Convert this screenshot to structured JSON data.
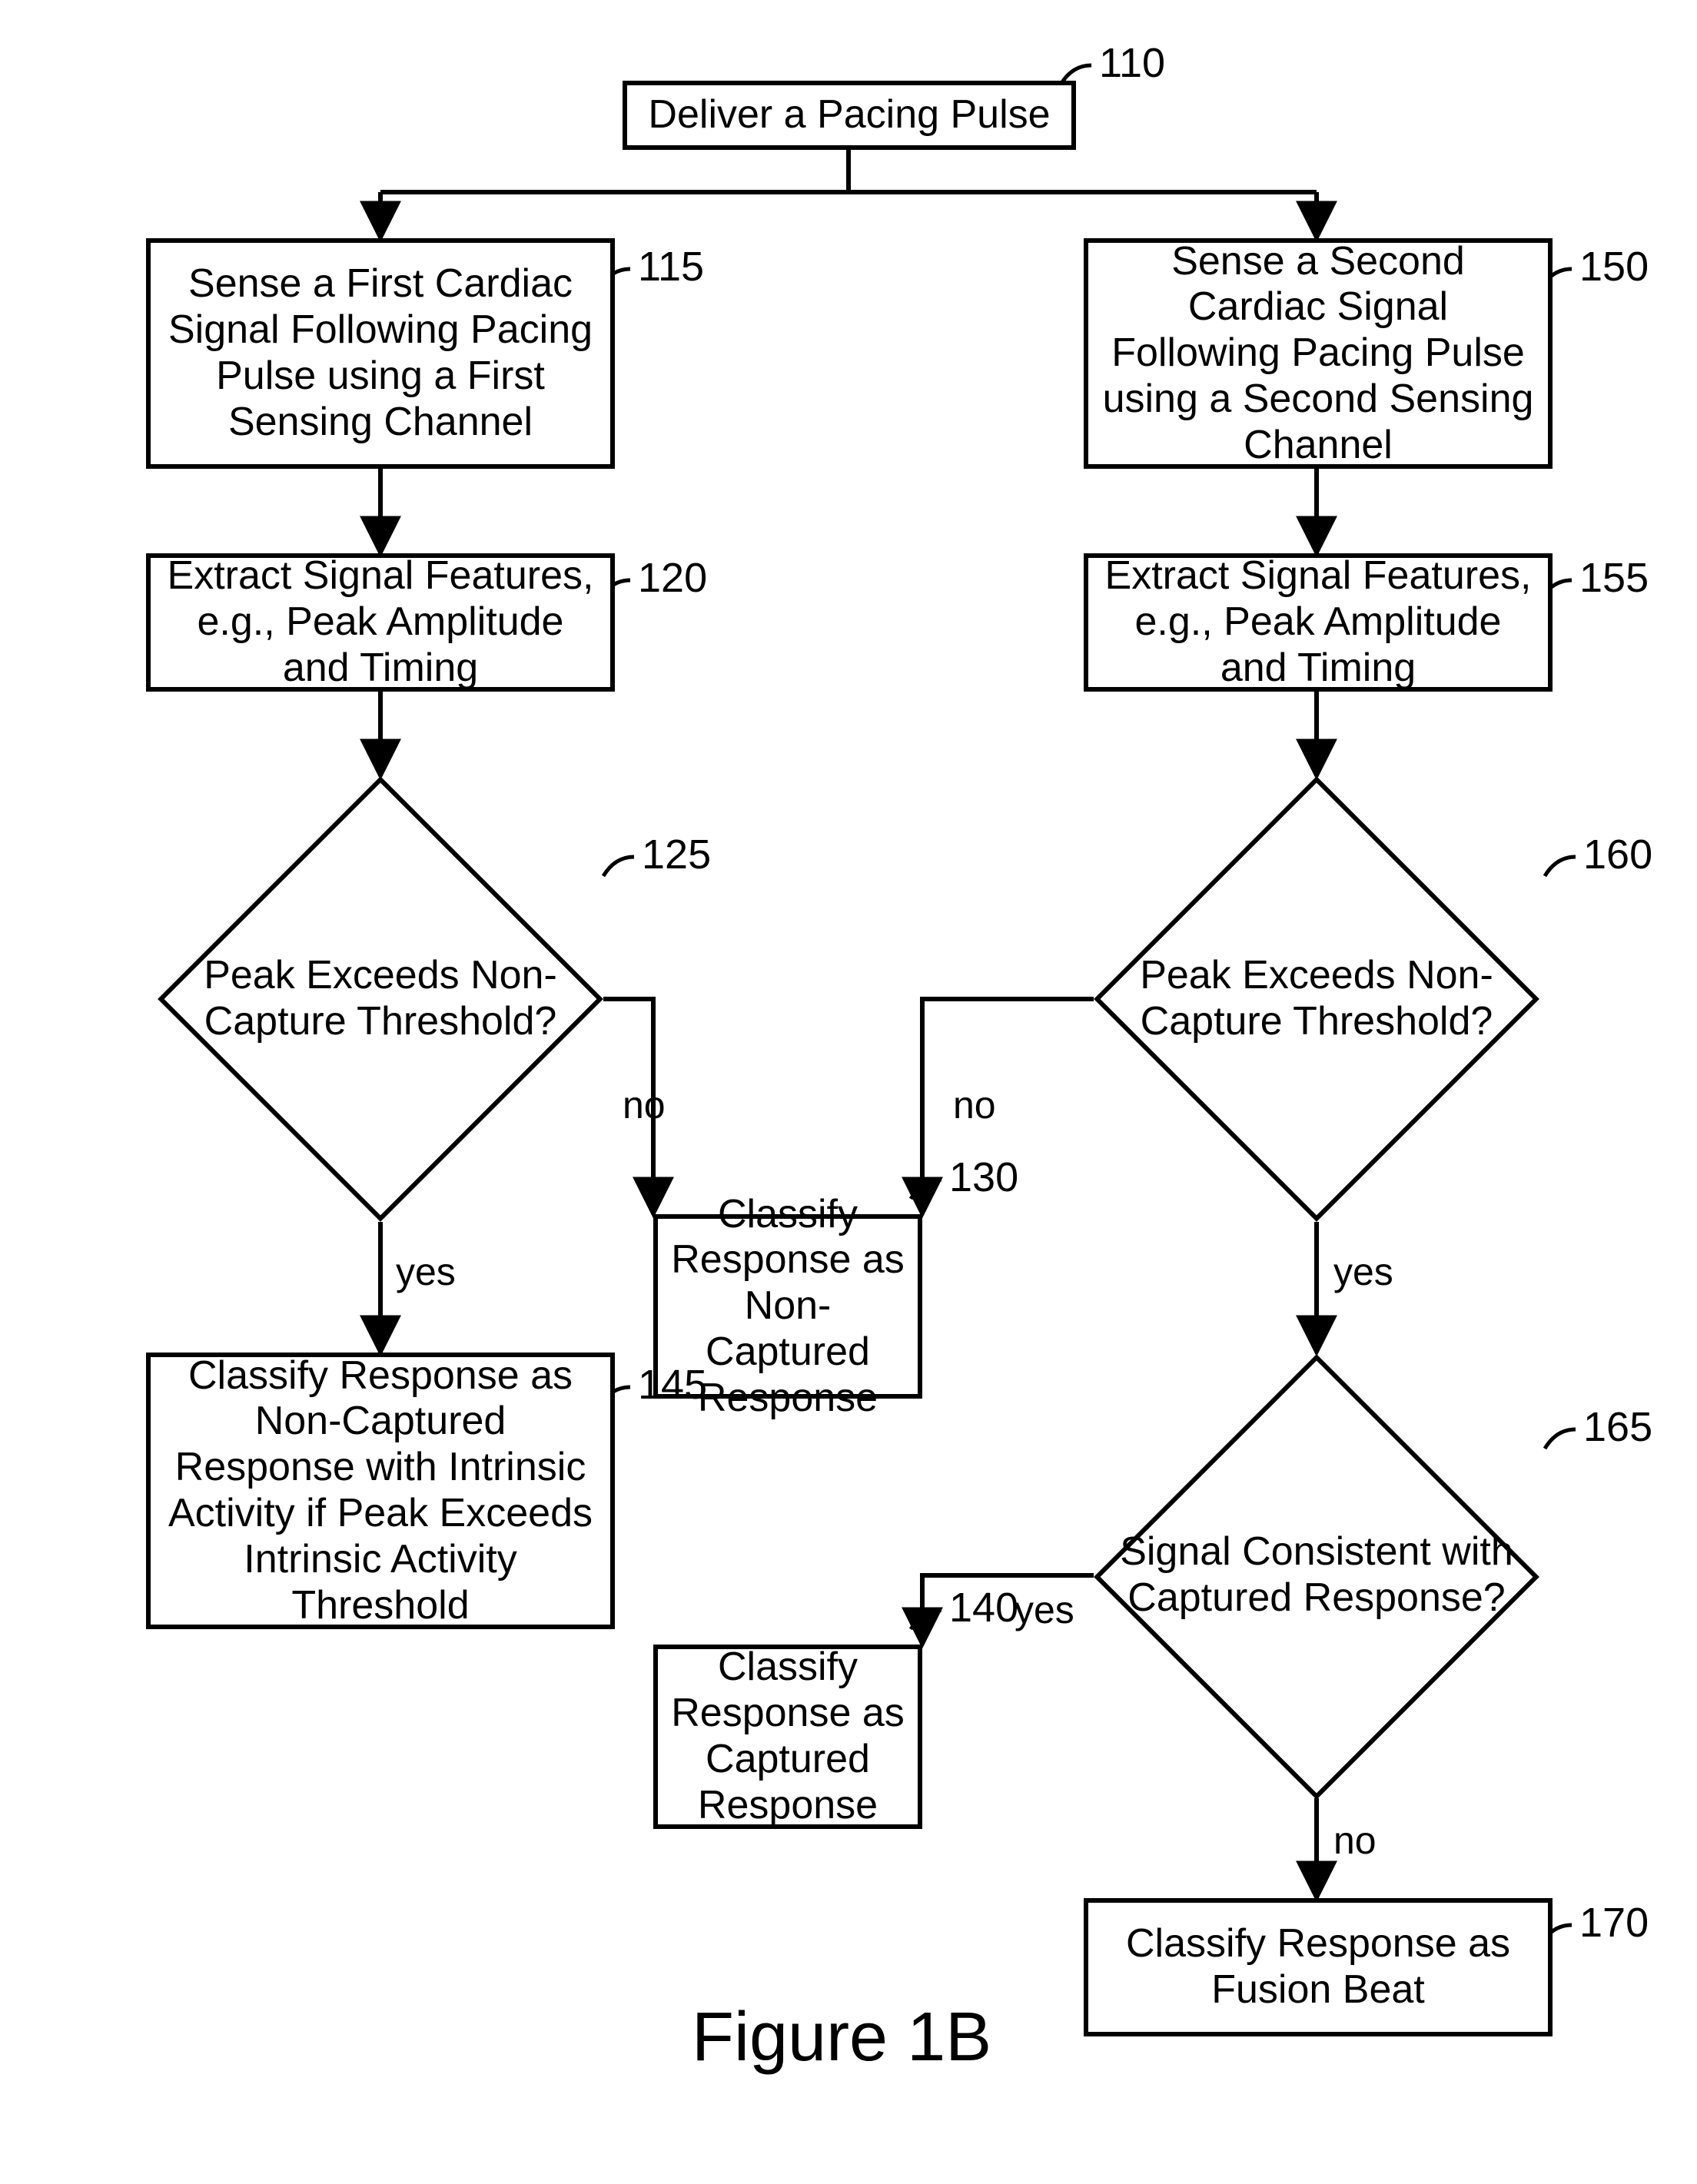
{
  "figure_title": "Figure 1B",
  "nodes": {
    "n110": {
      "id": "110",
      "text": "Deliver a Pacing Pulse"
    },
    "n115": {
      "id": "115",
      "text": "Sense a First Cardiac Signal Following Pacing Pulse using a First Sensing Channel"
    },
    "n150": {
      "id": "150",
      "text": "Sense a Second Cardiac Signal Following Pacing Pulse using a Second Sensing Channel"
    },
    "n120": {
      "id": "120",
      "text": "Extract Signal Features, e.g., Peak Amplitude and Timing"
    },
    "n155": {
      "id": "155",
      "text": "Extract Signal Features, e.g., Peak Amplitude and Timing"
    },
    "n125": {
      "id": "125",
      "text": "Peak Exceeds Non-Capture Threshold?"
    },
    "n160": {
      "id": "160",
      "text": "Peak Exceeds Non-Capture Threshold?"
    },
    "n130": {
      "id": "130",
      "text": "Classify Response as Non-Captured Response"
    },
    "n140": {
      "id": "140",
      "text": "Classify Response as Captured Response"
    },
    "n145": {
      "id": "145",
      "text": "Classify Response as Non-Captured Response with Intrinsic Activity if Peak Exceeds Intrinsic Activity Threshold"
    },
    "n165": {
      "id": "165",
      "text": "Signal Consistent with Captured Response?"
    },
    "n170": {
      "id": "170",
      "text": "Classify Response as Fusion Beat"
    }
  },
  "edge_labels": {
    "e125_no": "no",
    "e125_yes": "yes",
    "e160_no": "no",
    "e160_yes": "yes",
    "e165_yes": "yes",
    "e165_no": "no"
  }
}
